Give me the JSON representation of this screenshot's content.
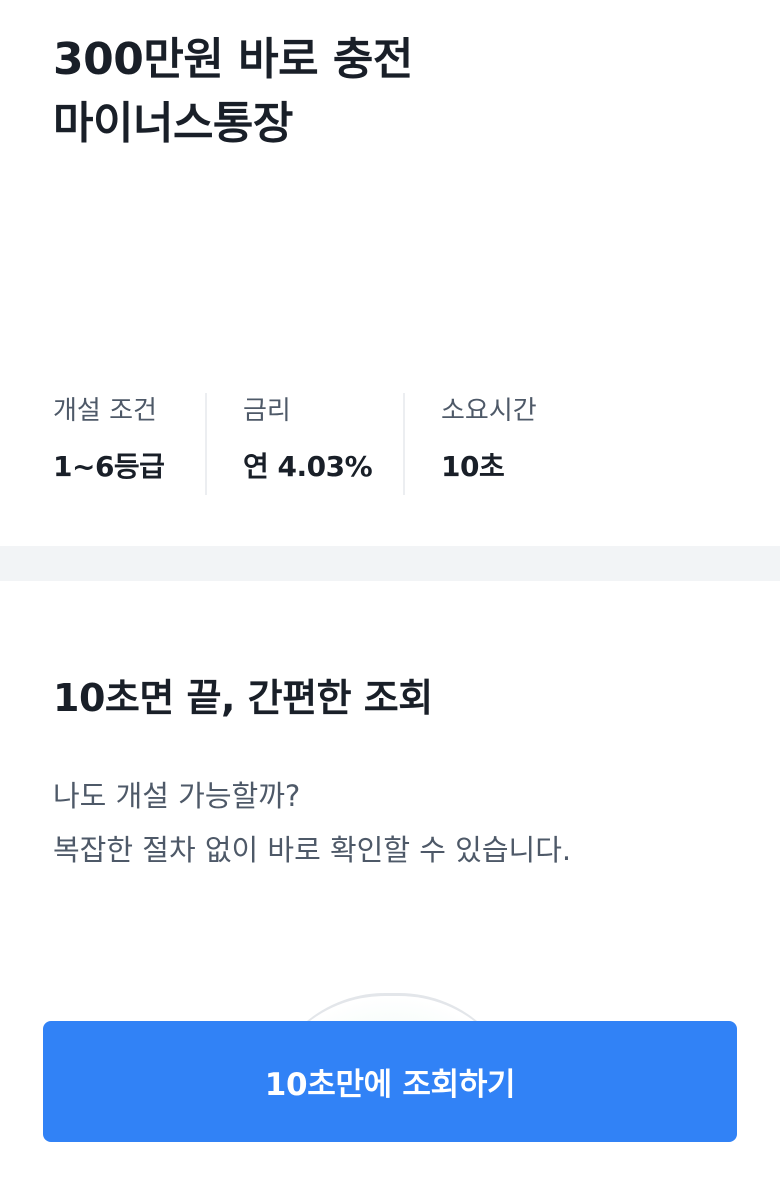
{
  "hero": {
    "title_line1": "300만원 바로 충전",
    "title_line2": "마이너스통장"
  },
  "info": [
    {
      "label": "개설 조건",
      "value": "1~6등급"
    },
    {
      "label": "금리",
      "value": "연 4.03%"
    },
    {
      "label": "소요시간",
      "value": "10초"
    }
  ],
  "section": {
    "title": "10초면 끝, 간편한 조회",
    "desc_line1": "나도 개설 가능할까?",
    "desc_line2": "복잡한 절차 없이 바로 확인할 수 있습니다."
  },
  "cta": {
    "label": "10초만에 조회하기"
  },
  "colors": {
    "primary": "#3182f6",
    "text_primary": "#191f28",
    "text_secondary": "#4e5968",
    "divider": "#f2f4f6"
  }
}
